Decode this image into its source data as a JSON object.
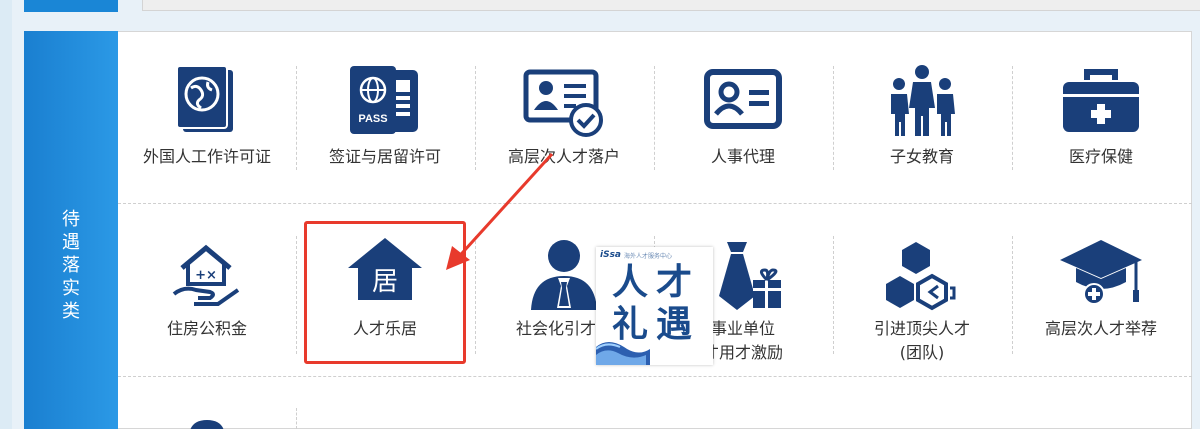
{
  "sidebar": {
    "category_chars": [
      "待",
      "遇",
      "落",
      "实",
      "类"
    ]
  },
  "services": {
    "row1": [
      {
        "label": "外国人工作许可证",
        "icon": "passport-globe-icon"
      },
      {
        "label": "签证与居留许可",
        "icon": "passport-pass-icon"
      },
      {
        "label": "高层次人才落户",
        "icon": "id-card-check-icon"
      },
      {
        "label": "人事代理",
        "icon": "profile-card-icon"
      },
      {
        "label": "子女教育",
        "icon": "family-icon"
      },
      {
        "label": "医疗保健",
        "icon": "medical-kit-icon"
      }
    ],
    "row2": [
      {
        "label": "住房公积金",
        "icon": "house-hand-icon"
      },
      {
        "label": "人才乐居",
        "icon": "house-ju-icon"
      },
      {
        "label": "社会化引才奖",
        "icon": "businessman-icon"
      },
      {
        "label": "事业单位",
        "label2": "才用才激励",
        "icon": "tie-gift-icon"
      },
      {
        "label": "引进顶尖人才",
        "label2": "(团队)",
        "icon": "hexagon-people-icon"
      },
      {
        "label": "高层次人才举荐",
        "icon": "graduate-cap-icon"
      }
    ]
  },
  "house_glyph": "居",
  "overlay": {
    "logo": "iSsa",
    "header": "海外人才服务中心",
    "chars": [
      "人",
      "才",
      "礼",
      "遇"
    ]
  },
  "colors": {
    "accent": "#1a86d6",
    "icon": "#1a3f7a",
    "highlight": "#e83a2c"
  }
}
